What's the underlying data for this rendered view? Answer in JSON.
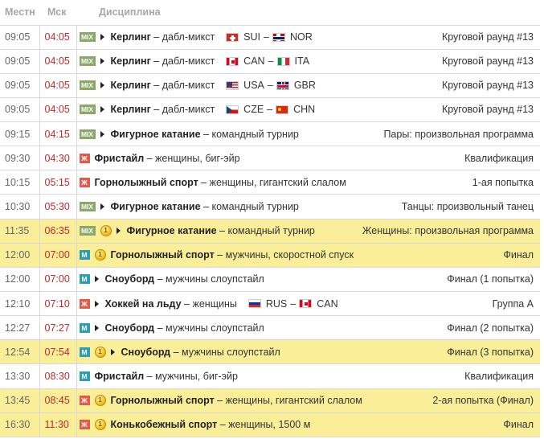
{
  "header": {
    "col_local": "Местн",
    "col_msk": "Мск",
    "col_discipline": "Дисциплина"
  },
  "badge_labels": {
    "mix": "MIX",
    "f": "Ж",
    "m": "М"
  },
  "colors": {
    "gold_row": "#fbee98",
    "moscow_time": "#c0282d",
    "mix_badge": "#8aa868",
    "women_badge": "#e25b4a",
    "men_badge": "#2e9fb3"
  },
  "rows": [
    {
      "local": "09:05",
      "msk": "04:05",
      "badge": "MIX",
      "medal": false,
      "arrow": true,
      "sport": "Керлинг",
      "event": "дабл-микст",
      "team1": "SUI",
      "flag1": "flag-sui",
      "team2": "NOR",
      "flag2": "flag-nor",
      "round": "Круговой раунд #13"
    },
    {
      "local": "09:05",
      "msk": "04:05",
      "badge": "MIX",
      "medal": false,
      "arrow": true,
      "sport": "Керлинг",
      "event": "дабл-микст",
      "team1": "CAN",
      "flag1": "flag-can",
      "team2": "ITA",
      "flag2": "flag-ita",
      "round": "Круговой раунд #13"
    },
    {
      "local": "09:05",
      "msk": "04:05",
      "badge": "MIX",
      "medal": false,
      "arrow": true,
      "sport": "Керлинг",
      "event": "дабл-микст",
      "team1": "USA",
      "flag1": "flag-usa",
      "team2": "GBR",
      "flag2": "flag-gbr",
      "round": "Круговой раунд #13"
    },
    {
      "local": "09:05",
      "msk": "04:05",
      "badge": "MIX",
      "medal": false,
      "arrow": true,
      "sport": "Керлинг",
      "event": "дабл-микст",
      "team1": "CZE",
      "flag1": "flag-cze",
      "team2": "CHN",
      "flag2": "flag-chn",
      "round": "Круговой раунд #13"
    },
    {
      "local": "09:15",
      "msk": "04:15",
      "badge": "MIX",
      "medal": false,
      "arrow": true,
      "sport": "Фигурное катание",
      "event": "командный турнир",
      "round": "Пары: произвольная программа"
    },
    {
      "local": "09:30",
      "msk": "04:30",
      "badge": "Ж",
      "medal": false,
      "arrow": false,
      "sport": "Фристайл",
      "event": "женщины, биг-эйр",
      "round": "Квалификация"
    },
    {
      "local": "10:15",
      "msk": "05:15",
      "badge": "Ж",
      "medal": false,
      "arrow": false,
      "sport": "Горнолыжный спорт",
      "event": "женщины, гигантский слалом",
      "round": "1-ая попытка"
    },
    {
      "local": "10:30",
      "msk": "05:30",
      "badge": "MIX",
      "medal": false,
      "arrow": true,
      "sport": "Фигурное катание",
      "event": "командный турнир",
      "round": "Танцы: произвольный танец"
    },
    {
      "local": "11:35",
      "msk": "06:35",
      "badge": "MIX",
      "medal": true,
      "arrow": true,
      "sport": "Фигурное катание",
      "event": "командный турнир",
      "round": "Женщины: произвольная программа"
    },
    {
      "local": "12:00",
      "msk": "07:00",
      "badge": "М",
      "medal": true,
      "arrow": false,
      "sport": "Горнолыжный спорт",
      "event": "мужчины, скоростной спуск",
      "round": "Финал"
    },
    {
      "local": "12:00",
      "msk": "07:00",
      "badge": "М",
      "medal": false,
      "arrow": true,
      "sport": "Сноуборд",
      "event": "мужчины слоупстайл",
      "round": "Финал (1 попытка)"
    },
    {
      "local": "12:10",
      "msk": "07:10",
      "badge": "Ж",
      "medal": false,
      "arrow": true,
      "sport": "Хоккей на льду",
      "event": "женщины",
      "team1": "RUS",
      "flag1": "flag-rus",
      "team2": "CAN",
      "flag2": "flag-can",
      "round": "Группа A"
    },
    {
      "local": "12:27",
      "msk": "07:27",
      "badge": "М",
      "medal": false,
      "arrow": true,
      "sport": "Сноуборд",
      "event": "мужчины слоупстайл",
      "round": "Финал (2 попытка)"
    },
    {
      "local": "12:54",
      "msk": "07:54",
      "badge": "М",
      "medal": true,
      "arrow": true,
      "sport": "Сноуборд",
      "event": "мужчины слоупстайл",
      "round": "Финал (3 попытка)"
    },
    {
      "local": "13:30",
      "msk": "08:30",
      "badge": "М",
      "medal": false,
      "arrow": false,
      "sport": "Фристайл",
      "event": "мужчины, биг-эйр",
      "round": "Квалификация"
    },
    {
      "local": "13:45",
      "msk": "08:45",
      "badge": "Ж",
      "medal": true,
      "arrow": false,
      "sport": "Горнолыжный спорт",
      "event": "женщины, гигантский слалом",
      "round": "2-ая попытка (Финал)"
    },
    {
      "local": "16:30",
      "msk": "11:30",
      "badge": "Ж",
      "medal": true,
      "arrow": false,
      "sport": "Конькобежный спорт",
      "event": "женщины, 1500 м",
      "round": "Финал"
    }
  ]
}
